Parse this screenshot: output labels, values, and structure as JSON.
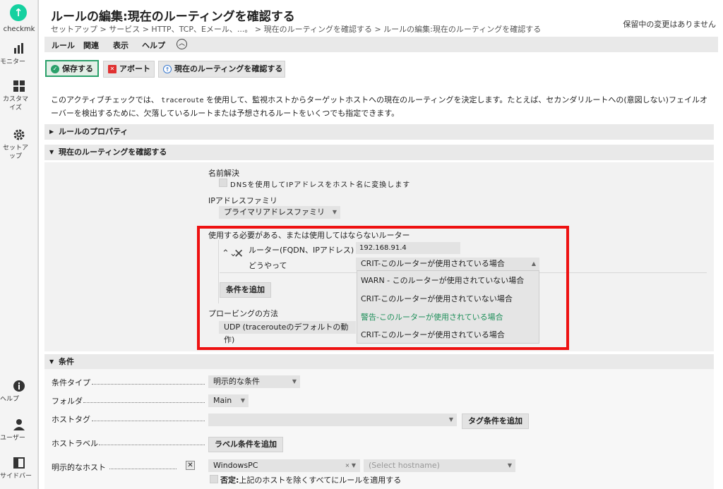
{
  "sidebar": {
    "logo_text": "checkmk",
    "items": [
      {
        "label": "モニター"
      },
      {
        "label": "カスタマイズ"
      },
      {
        "label": "セットアップ"
      },
      {
        "label": "ヘルプ"
      },
      {
        "label": "ユーザー"
      },
      {
        "label": "サイドバー"
      }
    ]
  },
  "header": {
    "title": "ルールの編集:現在のルーティングを確認する",
    "breadcrumb": "セットアップ > サービス > HTTP、TCP、Eメール、...。 > 現在のルーティングを確認する > ルールの編集:現在のルーティングを確認する",
    "pending": "保留中の変更はありません"
  },
  "menu": {
    "rule": "ルール",
    "related": "関連",
    "display": "表示",
    "help": "ヘルプ"
  },
  "toolbar": {
    "save": "保存する",
    "abort": "アボート",
    "check": "現在のルーティングを確認する"
  },
  "description": {
    "part1": "このアクティブチェックでは、",
    "command": "traceroute",
    "part2": "を使用して、監視ホストからターゲットホストへの現在のルーティングを決定します。たとえば、セカンダリルートへの(意図しない)フェイルオーバーを検出するために、欠落しているルートまたは予想されるルートをいくつでも指定できます。"
  },
  "sections": {
    "properties": "ルールのプロパティ",
    "check_routing": "現在のルーティングを確認する",
    "conditions": "条件"
  },
  "form": {
    "name_resolution_label": "名前解決",
    "dns_checkbox": "DNSを使用してIPアドレスをホスト名に変換します",
    "ip_family_label": "IPアドレスファミリ",
    "ip_family_value": "プライマリアドレスファミリ",
    "routers_label": "使用する必要がある、または使用してはならないルーター",
    "router_field_label": "ルーター(FQDN、IPアドレス)",
    "router_value": "192.168.91.4",
    "how_label": "どうやって",
    "how_value": "CRIT-このルーターが使用されている場合",
    "add_condition": "条件を追加",
    "probing_label": "プロービングの方法",
    "probing_value": "UDP (tracerouteのデフォルトの動作)",
    "dropdown_options": [
      "WARN - このルーターが使用されていない場合",
      "CRIT-このルーターが使用されていない場合",
      "警告-このルーターが使用されている場合",
      "CRIT-このルーターが使用されている場合"
    ]
  },
  "conditions": {
    "type_label": "条件タイプ",
    "type_value": "明示的な条件",
    "folder_label": "フォルダ",
    "folder_value": "Main",
    "hosttag_label": "ホストタグ",
    "add_tag": "タグ条件を追加",
    "hostlabel_label": "ホストラベル",
    "add_label": "ラベル条件を追加",
    "explicit_label": "明示的なホスト",
    "host_value": "WindowsPC",
    "host_placeholder": "(Select hostname)",
    "negate_strong": "否定:",
    "negate_text": "上記のホストを除くすべてにルールを適用する"
  },
  "colors": {
    "brand": "#15d1a0",
    "highlight": "#ee1111",
    "selected_option": "#1f8f5a"
  }
}
